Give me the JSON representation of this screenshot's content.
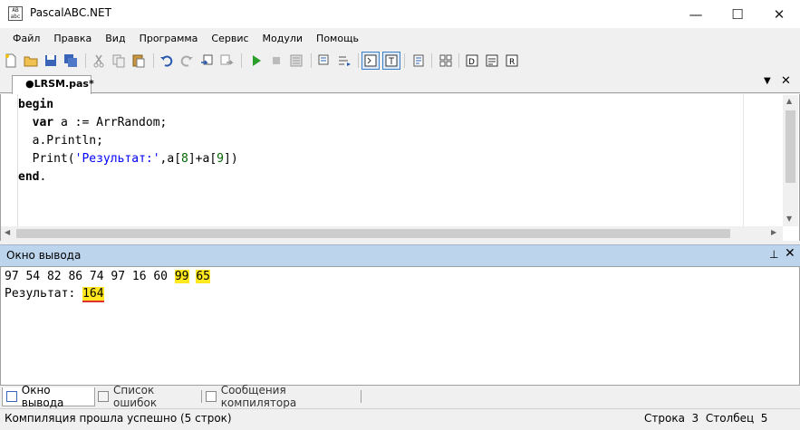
{
  "window": {
    "title": "PascalABC.NET",
    "app_icon_text": "AB\nabc",
    "minimize_glyph": "—",
    "maximize_glyph": "☐",
    "close_glyph": "✕"
  },
  "menu": [
    "Файл",
    "Правка",
    "Вид",
    "Программа",
    "Сервис",
    "Модули",
    "Помощь"
  ],
  "toolbar": {
    "icons": [
      "new-file-icon",
      "open-folder-icon",
      "save-icon",
      "save-all-icon",
      "cut-icon",
      "copy-icon",
      "paste-icon",
      "undo-icon",
      "redo-icon",
      "compile-icon",
      "build-icon",
      "run-icon",
      "stop-icon",
      "debug-icon",
      "step-into-icon",
      "step-over-icon",
      "console-icon",
      "text-icon",
      "format-icon",
      "properties-icon",
      "debug-windows-icon",
      "window-icon-1",
      "window-icon-2",
      "window-icon-3"
    ]
  },
  "editor": {
    "tab_label": "●LRSM.pas*",
    "tab_menu_glyph": "▼",
    "tab_close_glyph": "✕",
    "lines": {
      "l1_kw": "begin",
      "l2_indent": "  ",
      "l2_kw": "var",
      "l2_rest": " a := ArrRandom;",
      "l3": "  a.Println;",
      "l4_a": "  Print(",
      "l4_str": "'Результат:'",
      "l4_b": ",a[",
      "l4_n1": "8",
      "l4_c": "]+a[",
      "l4_n2": "9",
      "l4_d": "])",
      "l5_kw": "end",
      "l5_rest": "."
    }
  },
  "output": {
    "title": "Окно вывода",
    "pin_glyph": "⊥",
    "close_glyph": "✕",
    "numbers_plain": "97 54 82 86 74 97 16 60 ",
    "numbers_hl1": "99",
    "numbers_space": " ",
    "numbers_hl2": "65",
    "result_label": "Результат: ",
    "result_value": "164"
  },
  "bottom_tabs": [
    {
      "label": "Окно вывода",
      "active": true
    },
    {
      "label": "Список ошибок",
      "active": false
    },
    {
      "label": "Сообщения компилятора",
      "active": false
    }
  ],
  "status": {
    "message": "Компиляция прошла успешно (5 строк)",
    "position": "Строка  3  Столбец  5"
  },
  "colors": {
    "highlight": "#ffe81f",
    "underline": "#e03030",
    "panel_header": "#bcd4ec",
    "keyword": "#000000",
    "string": "#0000ff",
    "number": "#006400"
  }
}
